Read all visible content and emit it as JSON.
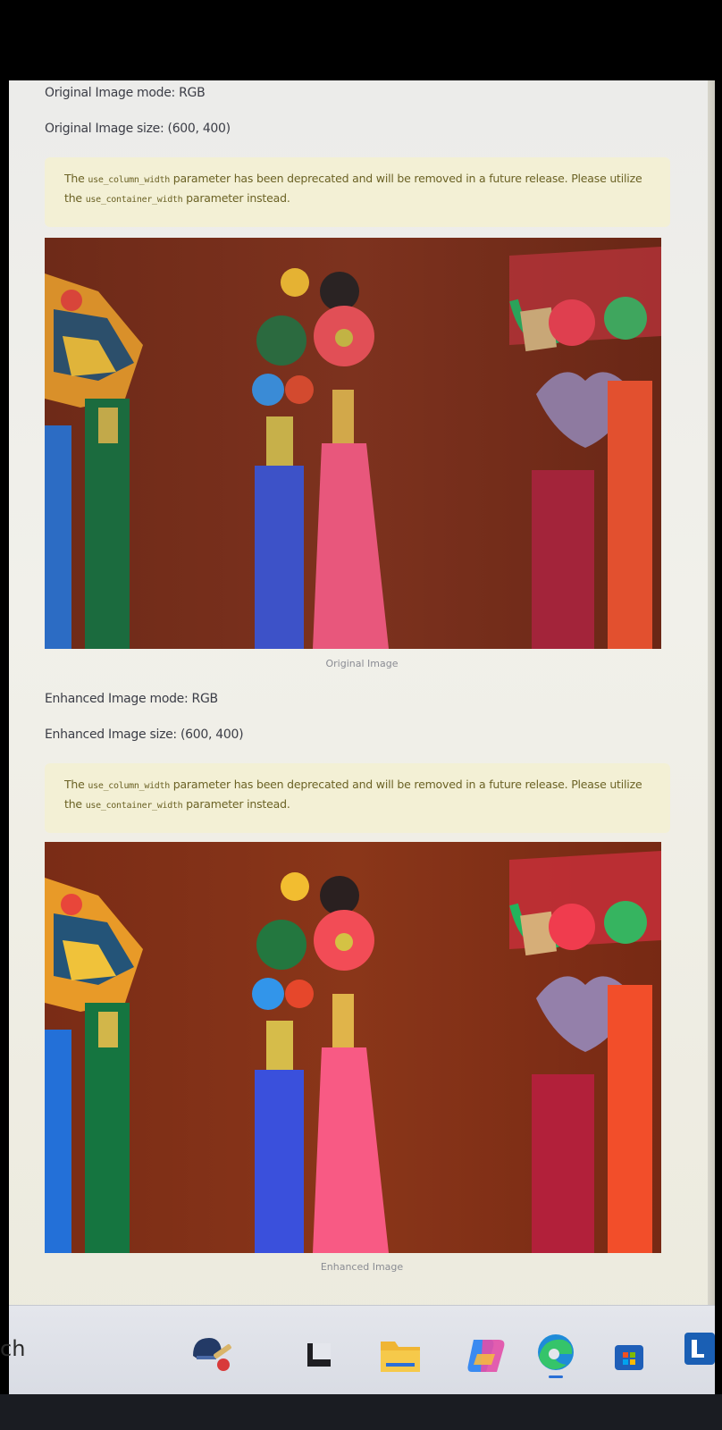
{
  "original": {
    "mode_text": "Original Image mode: RGB",
    "size_text": "Original Image size: (600, 400)",
    "warning": {
      "pre": "The ",
      "code1": "use_column_width",
      "mid": " parameter has been deprecated and will be removed in a future release. Please utilize the ",
      "code2": "use_container_width",
      "post": " parameter instead."
    },
    "caption": "Original Image"
  },
  "enhanced": {
    "mode_text": "Enhanced Image mode: RGB",
    "size_text": "Enhanced Image size: (600, 400)",
    "warning": {
      "pre": "The ",
      "code1": "use_column_width",
      "mid": " parameter has been deprecated and will be removed in a future release. Please utilize the ",
      "code2": "use_container_width",
      "post": " parameter instead."
    },
    "caption": "Enhanced Image"
  },
  "taskbar": {
    "search_fragment": "ch",
    "icons": [
      "cricket-game-icon",
      "task-view-icon",
      "file-explorer-icon",
      "copilot-icon",
      "edge-icon",
      "microsoft-store-icon",
      "linkedin-icon"
    ]
  },
  "colors": {
    "warning_bg": "#f3f0d5",
    "warning_text": "#6b6225",
    "wood": "#7a2f1c"
  }
}
